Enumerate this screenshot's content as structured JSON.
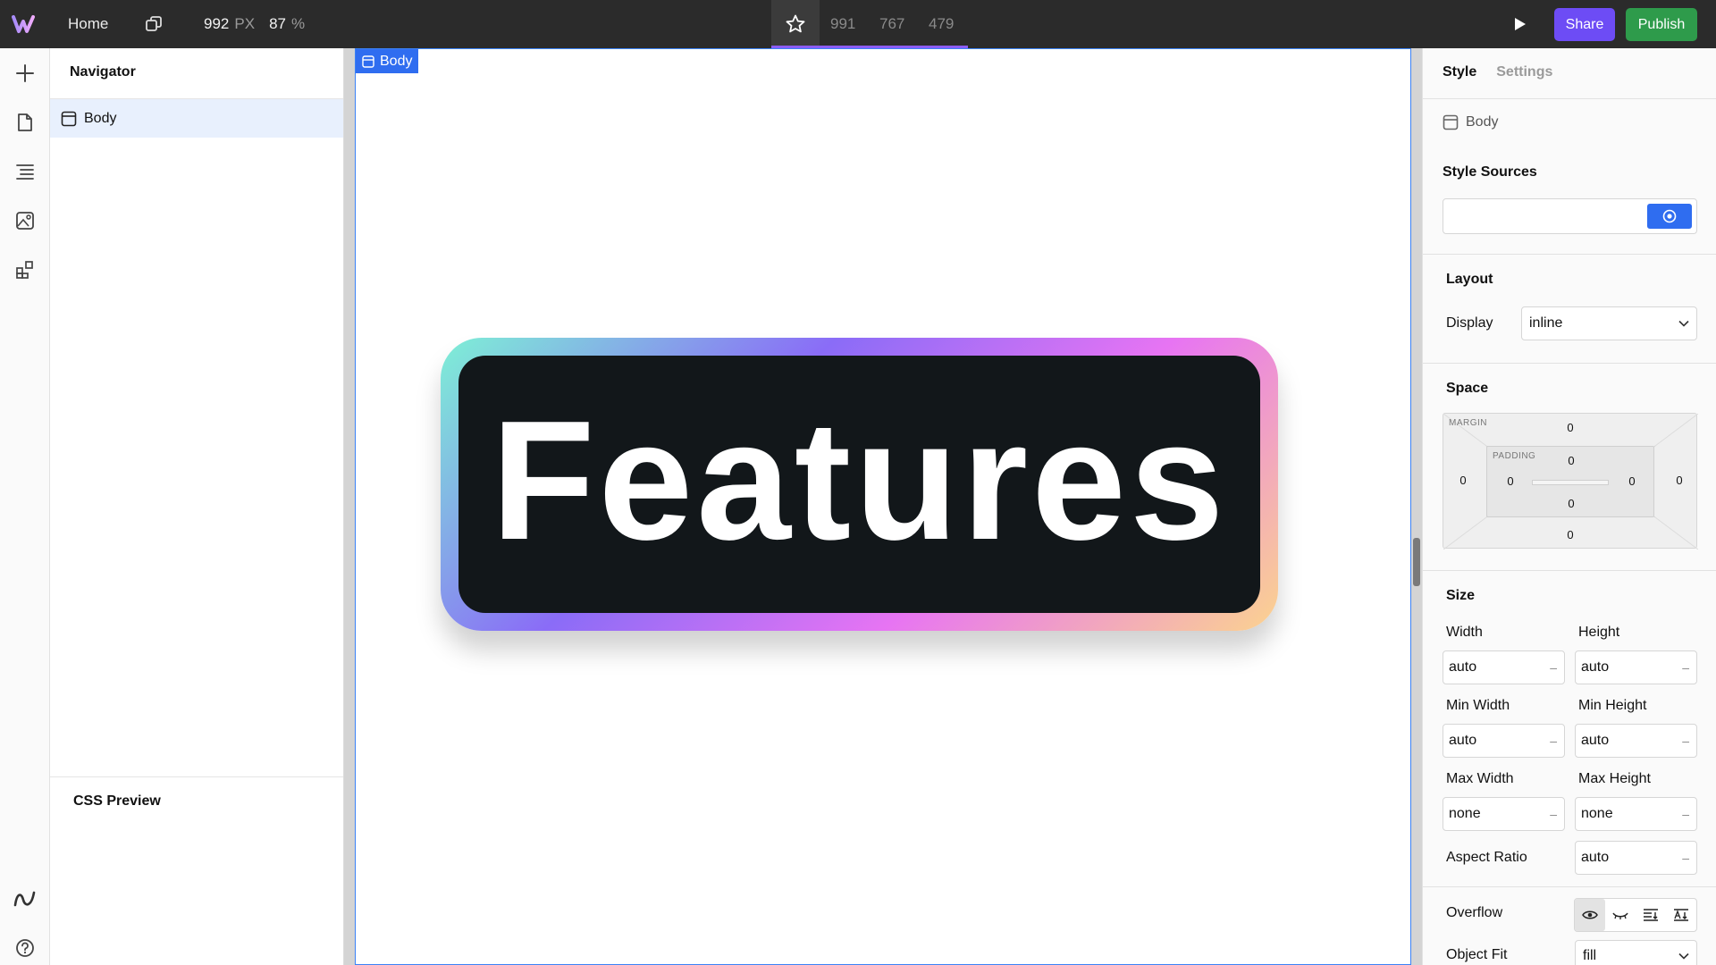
{
  "topbar": {
    "home_label": "Home",
    "width_value": "992",
    "width_unit": "PX",
    "zoom_value": "87",
    "zoom_unit": "%",
    "breakpoints": [
      "991",
      "767",
      "479"
    ],
    "share_label": "Share",
    "publish_label": "Publish"
  },
  "toolbar": {
    "icons": [
      "plus-icon",
      "page-icon",
      "navigator-icon",
      "assets-icon",
      "components-icon",
      "logo-mark-icon",
      "help-icon"
    ]
  },
  "navigator": {
    "title": "Navigator",
    "items": [
      {
        "label": "Body"
      }
    ],
    "css_preview_title": "CSS Preview"
  },
  "canvas": {
    "body_tag": "Body",
    "feature_text": "Features"
  },
  "style_panel": {
    "tabs": {
      "style": "Style",
      "settings": "Settings"
    },
    "selected_element": "Body",
    "style_sources_title": "Style Sources",
    "layout_title": "Layout",
    "display_label": "Display",
    "display_value": "inline",
    "space_title": "Space",
    "margin_label": "MARGIN",
    "padding_label": "PADDING",
    "margin": {
      "top": "0",
      "right": "0",
      "bottom": "0",
      "left": "0"
    },
    "padding": {
      "top": "0",
      "right": "0",
      "bottom": "0",
      "left": "0"
    },
    "size_title": "Size",
    "width_label": "Width",
    "width_value": "auto",
    "height_label": "Height",
    "height_value": "auto",
    "min_width_label": "Min Width",
    "min_width_value": "auto",
    "min_height_label": "Min Height",
    "min_height_value": "auto",
    "max_width_label": "Max Width",
    "max_width_value": "none",
    "max_height_label": "Max Height",
    "max_height_value": "none",
    "aspect_ratio_label": "Aspect Ratio",
    "aspect_ratio_value": "auto",
    "overflow_label": "Overflow",
    "object_fit_label": "Object Fit",
    "object_fit_value": "fill"
  },
  "colors": {
    "accent_blue": "#2f6df0",
    "share_purple": "#6d4cf5",
    "publish_green": "#2e9b4b",
    "topbar_bg": "#2b2b2b"
  }
}
